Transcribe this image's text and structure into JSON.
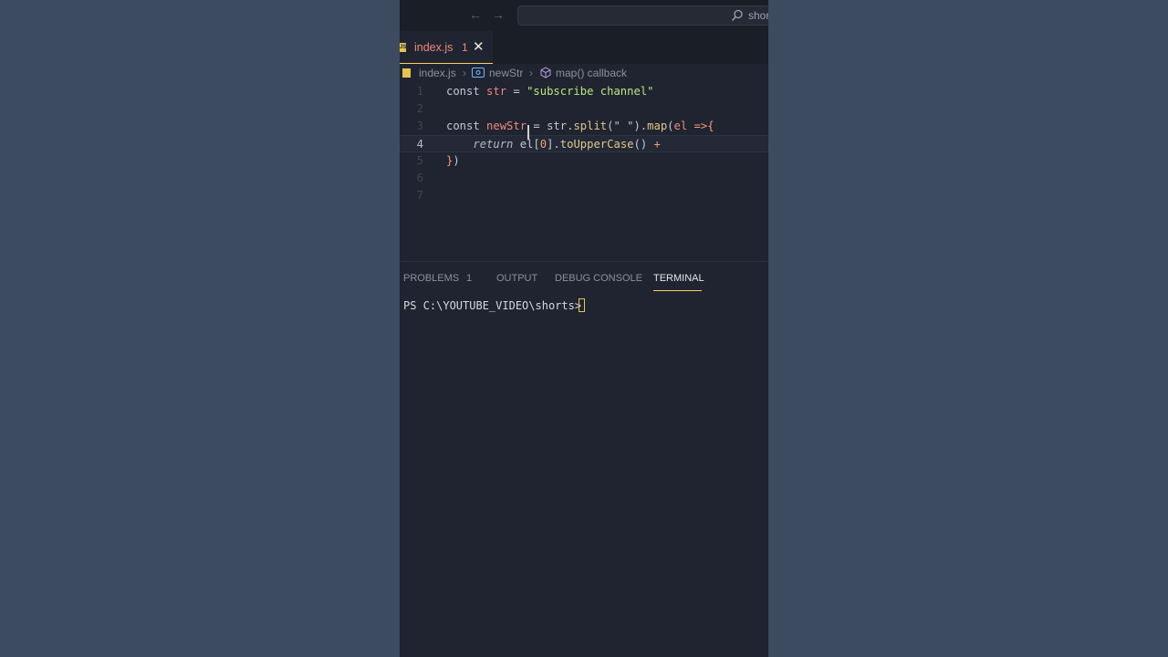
{
  "titlebar": {
    "back_icon": "arrow-left-icon",
    "forward_icon": "arrow-right-icon",
    "search_text": "shor"
  },
  "tab": {
    "label": "index.js",
    "problem_count": "1",
    "close_glyph": "✕"
  },
  "breadcrumb": {
    "file": "index.js",
    "symbol": "newStr",
    "callback": "map() callback"
  },
  "editor": {
    "active_line": 4,
    "lines": [
      {
        "n": "1",
        "tokens": [
          [
            "kw",
            "const "
          ],
          [
            "var",
            "str"
          ],
          [
            "plain",
            " = "
          ],
          [
            "str",
            "\"subscribe channel\""
          ]
        ]
      },
      {
        "n": "2",
        "tokens": []
      },
      {
        "n": "3",
        "tokens": [
          [
            "kw",
            "const "
          ],
          [
            "var",
            "newStr"
          ],
          [
            "plain",
            " = str."
          ],
          [
            "fn",
            "split"
          ],
          [
            "plain",
            "(\" \")."
          ],
          [
            "fn",
            "map"
          ],
          [
            "plain",
            "("
          ],
          [
            "var",
            "el"
          ],
          [
            "op",
            " =>"
          ],
          [
            "brace",
            "{"
          ]
        ]
      },
      {
        "n": "4",
        "tokens": [
          [
            "plain",
            "    "
          ],
          [
            "ret",
            "return"
          ],
          [
            "plain",
            " el["
          ],
          [
            "op",
            "0"
          ],
          [
            "plain",
            "]."
          ],
          [
            "fn",
            "toUpperCase"
          ],
          [
            "plain",
            "() "
          ],
          [
            "op",
            "+"
          ]
        ]
      },
      {
        "n": "5",
        "tokens": [
          [
            "brace",
            "}"
          ],
          [
            "plain",
            ")"
          ]
        ]
      },
      {
        "n": "6",
        "tokens": []
      },
      {
        "n": "7",
        "tokens": []
      }
    ]
  },
  "panel": {
    "tabs": [
      {
        "label": "PROBLEMS",
        "active": false
      },
      {
        "label": "1",
        "active": false
      },
      {
        "label": "OUTPUT",
        "active": false
      },
      {
        "label": "DEBUG CONSOLE",
        "active": false
      },
      {
        "label": "TERMINAL",
        "active": true
      }
    ],
    "terminal_prompt": "PS C:\\YOUTUBE_VIDEO\\shorts> "
  },
  "colors": {
    "accent": "#ffcc66",
    "error": "#f28779",
    "string": "#bae67e"
  }
}
